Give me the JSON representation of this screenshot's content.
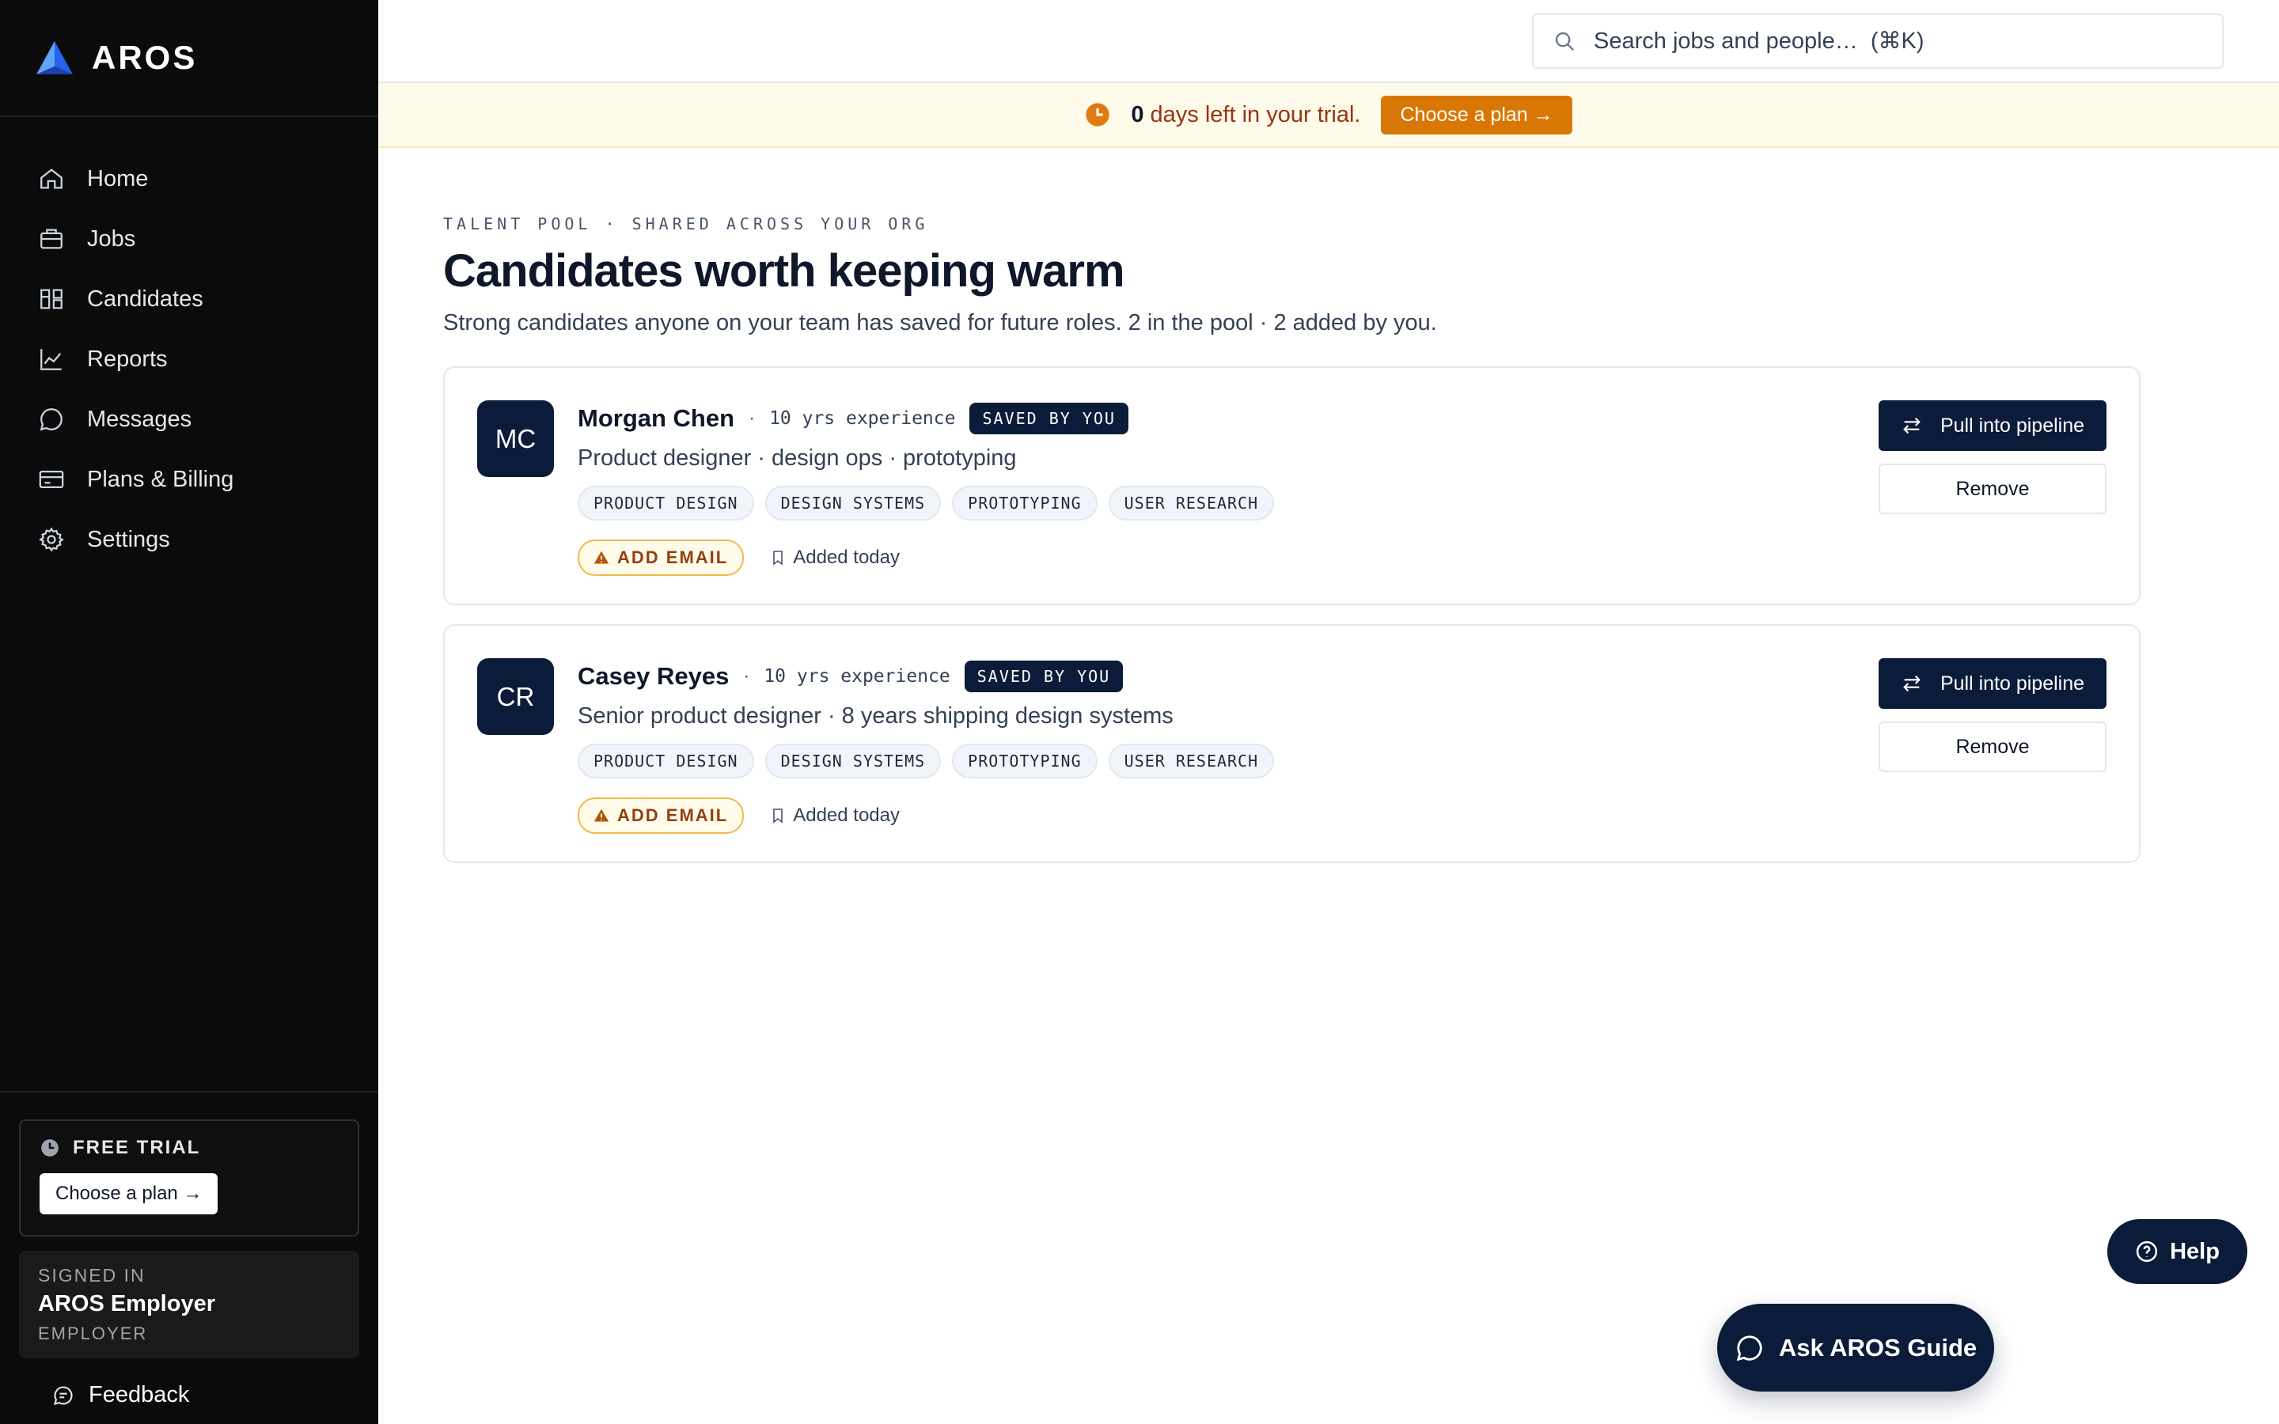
{
  "app": {
    "brand": "AROS"
  },
  "sidebar": {
    "items": [
      {
        "label": "Home",
        "icon": "home-icon"
      },
      {
        "label": "Jobs",
        "icon": "briefcase-icon"
      },
      {
        "label": "Candidates",
        "icon": "board-icon"
      },
      {
        "label": "Reports",
        "icon": "chart-icon"
      },
      {
        "label": "Messages",
        "icon": "chat-icon"
      },
      {
        "label": "Plans & Billing",
        "icon": "card-icon"
      },
      {
        "label": "Settings",
        "icon": "gear-icon"
      }
    ],
    "trial": {
      "label": "FREE TRIAL",
      "button": "Choose a plan →"
    },
    "signed_in": {
      "label": "SIGNED IN",
      "name": "AROS Employer",
      "role": "EMPLOYER"
    },
    "feedback": "Feedback"
  },
  "search": {
    "placeholder": "Search jobs and people…  (⌘K)"
  },
  "banner": {
    "days": "0",
    "text": "days left in your trial.",
    "button": "Choose a plan →"
  },
  "page": {
    "eyebrow": "TALENT POOL · SHARED ACROSS YOUR ORG",
    "title": "Candidates worth keeping warm",
    "subtitle": "Strong candidates anyone on your team has saved for future roles. 2 in the pool · 2 added by you."
  },
  "candidates": [
    {
      "initials": "MC",
      "name": "Morgan Chen",
      "experience": "10 yrs experience",
      "badge": "SAVED BY YOU",
      "headline": "Product designer · design ops · prototyping",
      "tags": [
        "PRODUCT DESIGN",
        "DESIGN SYSTEMS",
        "PROTOTYPING",
        "USER RESEARCH"
      ],
      "email_badge": "ADD EMAIL",
      "added": "Added today",
      "pull_label": "Pull into pipeline",
      "remove_label": "Remove"
    },
    {
      "initials": "CR",
      "name": "Casey Reyes",
      "experience": "10 yrs experience",
      "badge": "SAVED BY YOU",
      "headline": "Senior product designer · 8 years shipping design systems",
      "tags": [
        "PRODUCT DESIGN",
        "DESIGN SYSTEMS",
        "PROTOTYPING",
        "USER RESEARCH"
      ],
      "email_badge": "ADD EMAIL",
      "added": "Added today",
      "pull_label": "Pull into pipeline",
      "remove_label": "Remove"
    }
  ],
  "floating": {
    "help": "Help",
    "guide": "Ask AROS Guide"
  },
  "colors": {
    "navy": "#0b1b3a",
    "amber": "#d97706",
    "sidebar": "#0b0b0b"
  }
}
